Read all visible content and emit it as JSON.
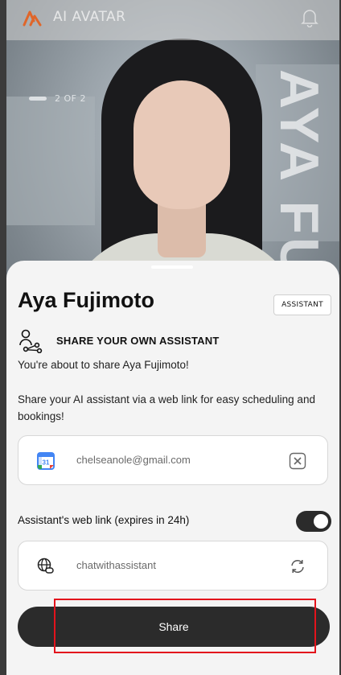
{
  "header": {
    "brand": "AI AVATAR",
    "logo_icon": "ai-logo-icon",
    "bell_icon": "bell-icon"
  },
  "hero": {
    "pager_text": "2 OF 2",
    "vertical_name": "AYA FU"
  },
  "sheet": {
    "name": "Aya Fujimoto",
    "badge": "ASSISTANT",
    "share_title": "SHARE YOUR OWN ASSISTANT",
    "about_text": "You're about to share Aya Fujimoto!",
    "description": "Share your AI assistant via a web link for easy scheduling and bookings!",
    "email_field": {
      "icon": "google-calendar-icon",
      "value": "chelseanole@gmail.com",
      "trail_icon": "clear-icon"
    },
    "web_link": {
      "label": "Assistant's web link (expires in 24h)",
      "toggle_on": true
    },
    "link_field": {
      "icon": "globe-link-icon",
      "value": "chatwithassistant",
      "trail_icon": "refresh-icon"
    },
    "share_button": "Share"
  },
  "colors": {
    "accent_logo": "#e0662a",
    "button_dark": "#2b2b2b",
    "highlight": "#e3131c"
  }
}
